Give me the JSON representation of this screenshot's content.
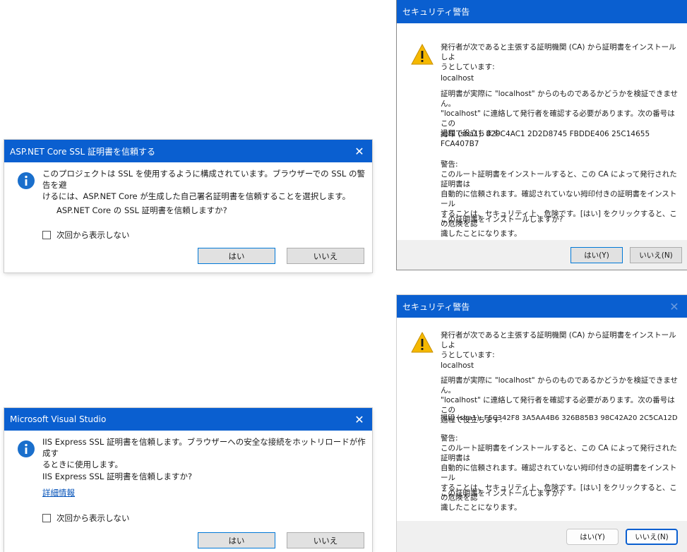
{
  "dialogs": {
    "aspnet": {
      "title": "ASP.NET Core SSL 証明書を信頼する",
      "message_line1": "このプロジェクトは SSL を使用するように構成されています。ブラウザーでの SSL の警告を避",
      "message_line2": "けるには、ASP.NET Core が生成した自己署名証明書を信頼することを選択します。",
      "question": "ASP.NET Core の SSL 証明書を信頼しますか?",
      "checkbox_label": "次回から表示しない",
      "yes_label": "はい",
      "no_label": "いいえ",
      "close_glyph": "✕"
    },
    "vs": {
      "title": "Microsoft Visual Studio",
      "message_line1": "IIS Express SSL 証明書を信頼します。ブラウザーへの安全な接続をホットリロードが作成す",
      "message_line2": "るときに使用します。",
      "question": "IIS Express SSL 証明書を信頼しますか?",
      "link_label": "詳細情報",
      "checkbox_label": "次回から表示しない",
      "yes_label": "はい",
      "no_label": "いいえ",
      "close_glyph": "✕"
    },
    "security1": {
      "title": "セキュリティ警告",
      "msg_line1": "発行者が次であると主張する証明機関 (CA) から証明書をインストールしよ",
      "msg_line2": "うとしています:",
      "host": "localhost",
      "verify_line1": "証明書が実際に \"localhost\" からのものであるかどうかを検証できません。",
      "verify_line2": "\"localhost\" に連絡して発行者を確認する必要があります。次の番号はこの",
      "verify_line3": "過程で役立ちます:",
      "thumb_line1": "拇印 (sha1): 029C4AC1 2D2D8745 FBDDE406 25C14655",
      "thumb_line2": "FCA407B7",
      "warn_head": "警告:",
      "warn_line1": "このルート証明書をインストールすると、この CA によって発行された証明書は",
      "warn_line2": "自動的に信頼されます。確認されていない拇印付きの証明書をインストール",
      "warn_line3": "することは、セキュリティ上、危険です。[はい] をクリックすると、この危険を認",
      "warn_line4": "識したことになります。",
      "question": "この証明書をインストールしますか?",
      "yes_label": "はい(Y)",
      "no_label": "いいえ(N)"
    },
    "security2": {
      "title": "セキュリティ警告",
      "msg_line1": "発行者が次であると主張する証明機関 (CA) から証明書をインストールしよ",
      "msg_line2": "うとしています:",
      "host": "localhost",
      "verify_line1": "証明書が実際に \"localhost\" からのものであるかどうかを検証できません。",
      "verify_line2": "\"localhost\" に連絡して発行者を確認する必要があります。次の番号はこの",
      "verify_line3": "過程で役立ちます:",
      "thumb_line1": "拇印 (sha1): F5C342F8 3A5AA4B6 326B85B3 98C42A20 2C5CA12D",
      "warn_head": "警告:",
      "warn_line1": "このルート証明書をインストールすると、この CA によって発行された証明書は",
      "warn_line2": "自動的に信頼されます。確認されていない拇印付きの証明書をインストール",
      "warn_line3": "することは、セキュリティ上、危険です。[はい] をクリックすると、この危険を認",
      "warn_line4": "識したことになります。",
      "question": "この証明書をインストールしますか?",
      "yes_label": "はい(Y)",
      "no_label": "いいえ(N)",
      "close_glyph": "✕"
    }
  },
  "colors": {
    "titlebar": "#0a5fd0",
    "info_icon": "#1a6fcc",
    "warning_icon": "#f5b800",
    "button_bar": "#f0f0f0"
  }
}
